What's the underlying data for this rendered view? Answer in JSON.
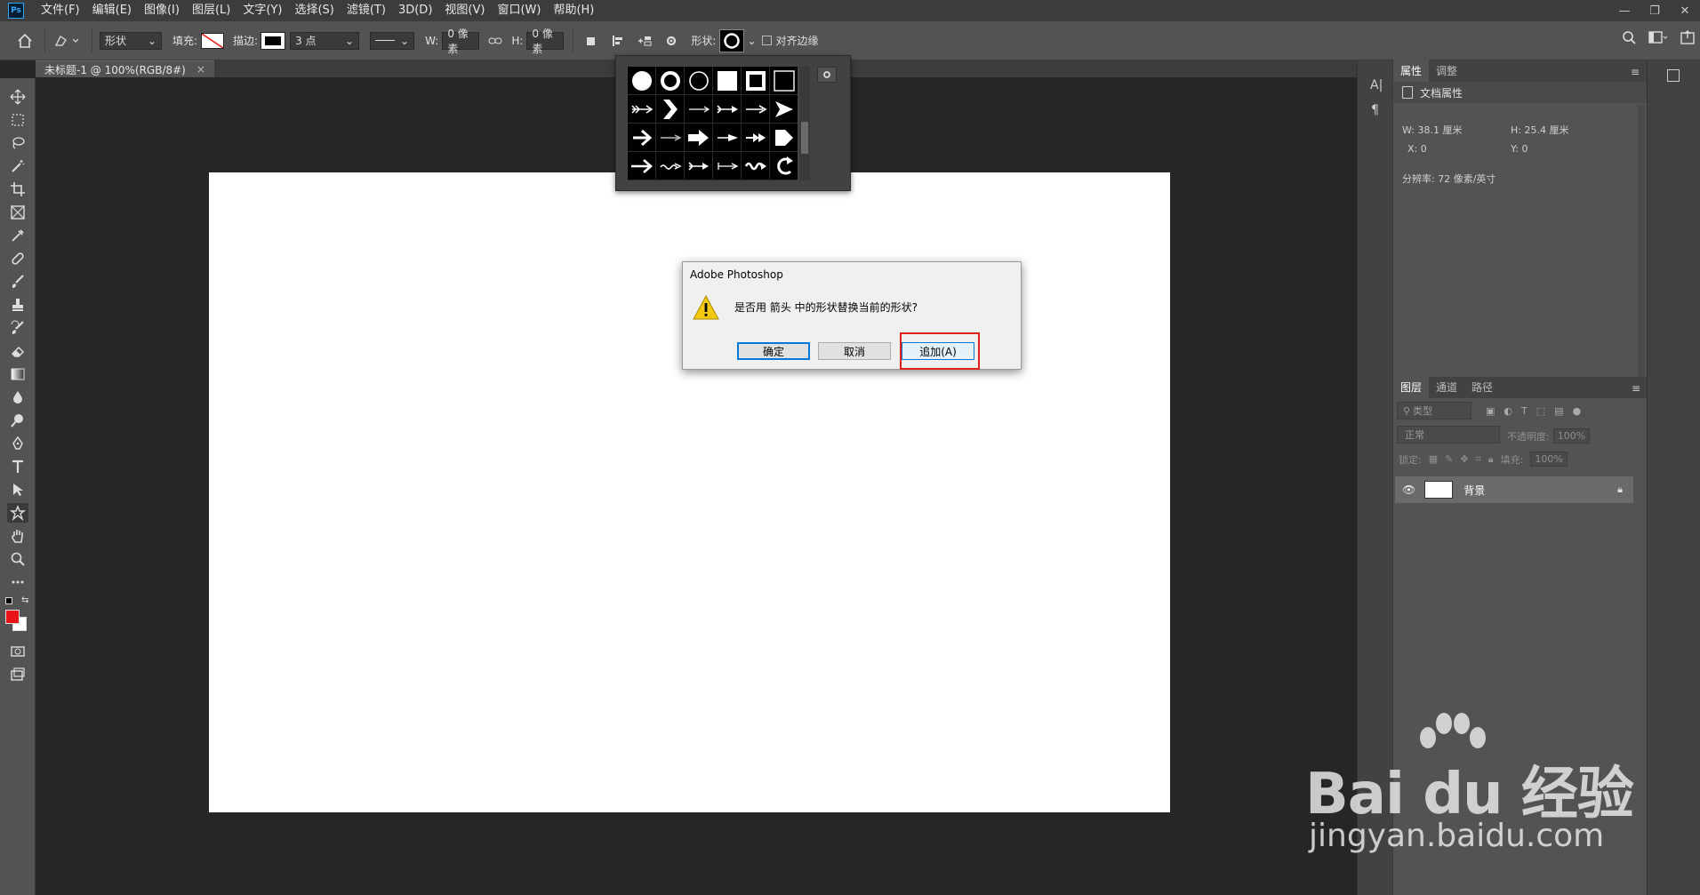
{
  "app": {
    "logo": "Ps"
  },
  "menu": [
    "文件(F)",
    "编辑(E)",
    "图像(I)",
    "图层(L)",
    "文字(Y)",
    "选择(S)",
    "滤镜(T)",
    "3D(D)",
    "视图(V)",
    "窗口(W)",
    "帮助(H)"
  ],
  "window_controls": {
    "minimize": "—",
    "restore": "❐",
    "close": "✕"
  },
  "options": {
    "mode": "形状",
    "fill_label": "填充:",
    "stroke_label": "描边:",
    "stroke_size": "3 点",
    "w_label": "W:",
    "w_value": "0 像素",
    "h_label": "H:",
    "h_value": "0 像素",
    "shape_label": "形状:",
    "align_edges": "对齐边缘"
  },
  "document_tab": {
    "title": "未标题-1 @ 100%(RGB/8#)",
    "close": "×"
  },
  "colors": {
    "foreground": "#e8141a",
    "background": "#ffffff",
    "highlight": "#e0211b"
  },
  "properties_panel": {
    "tabs": [
      "属性",
      "调整"
    ],
    "header": "文档属性",
    "w_label": "W:",
    "w_value": "38.1 厘米",
    "h_label": "H:",
    "h_value": "25.4 厘米",
    "x_label": "X:",
    "x_value": "0",
    "y_label": "Y:",
    "y_value": "0",
    "resolution": "分辨率: 72 像素/英寸"
  },
  "layers_panel": {
    "tabs": [
      "图层",
      "通道",
      "路径"
    ],
    "filter_placeholder": "类型",
    "blend_mode": "正常",
    "opacity_label": "不透明度:",
    "opacity_value": "100%",
    "lock_label": "锁定:",
    "fill_label": "填充:",
    "fill_value": "100%",
    "layers": [
      {
        "name": "背景",
        "visible": true,
        "locked": true
      }
    ]
  },
  "dialog": {
    "title": "Adobe Photoshop",
    "message": "是否用 箭头 中的形状替换当前的形状?",
    "buttons": {
      "ok": "确定",
      "cancel": "取消",
      "append": "追加(A)"
    }
  },
  "side_icons": {
    "char": "A|",
    "para": "¶"
  },
  "watermark": {
    "brand": "Bai du 经验",
    "url": "jingyan.baidu.com"
  }
}
